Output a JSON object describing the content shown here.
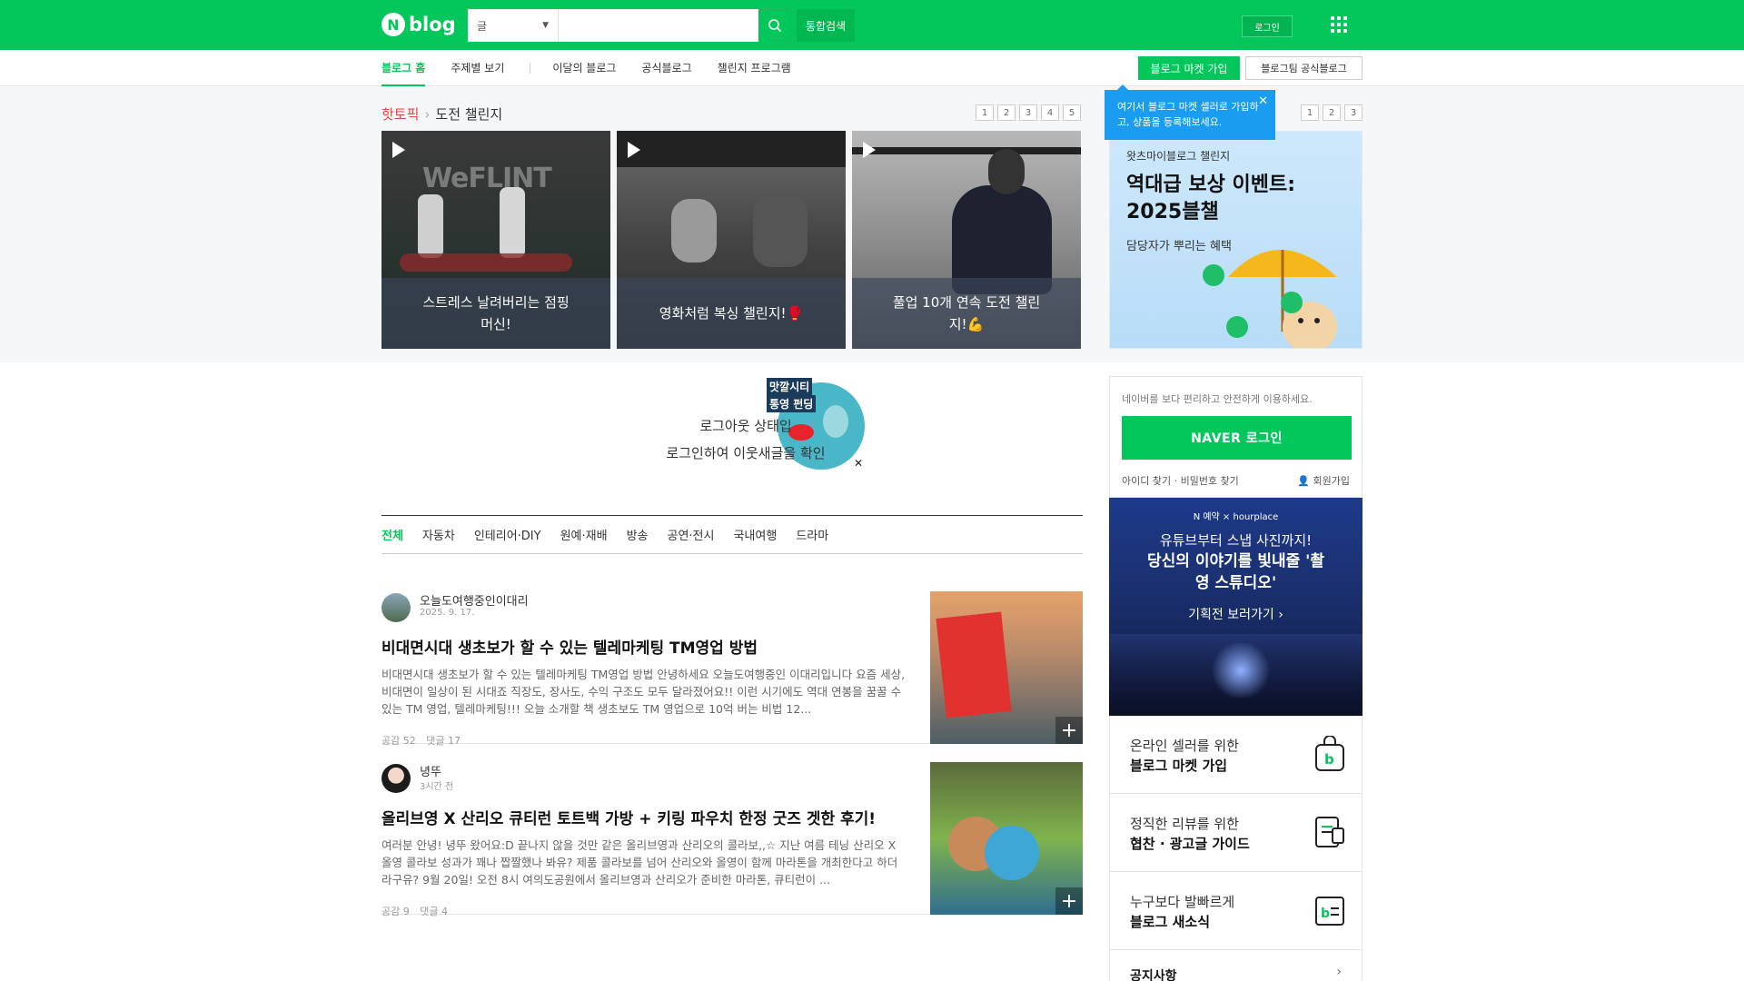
{
  "header": {
    "logo_letter": "N",
    "logo_text": "blog",
    "search_scope": "글",
    "search_value": "",
    "search_placeholder": "",
    "search_all_label": "통합검색",
    "login_label": "로그인"
  },
  "lnb": {
    "items": [
      "블로그 홈",
      "주제별 보기",
      "이달의 블로그",
      "공식블로그",
      "챌린지 프로그램"
    ],
    "market_button": "블로그 마켓 가입",
    "official_button": "블로그팀 공식블로그"
  },
  "hot_topic": {
    "label": "핫토픽",
    "subject": "도전 챌린지",
    "pages": [
      "1",
      "2",
      "3",
      "4",
      "5"
    ],
    "cards": [
      {
        "caption": "스트레스 날려버리는 점핑 머신!"
      },
      {
        "caption": "영화처럼 복싱 챌린지!🥊"
      },
      {
        "caption": "풀업 10개 연속 도전 챌린지!💪"
      }
    ]
  },
  "banner": {
    "pages": [
      "1",
      "2",
      "3"
    ],
    "kicker": "왓츠마이블로그 챌린지",
    "headline": "역대급 보상 이벤트: 2025블챌",
    "sub": "담당자가 뿌리는 혜택"
  },
  "tooltip": {
    "text": "여기서 블로그 마켓 셀러로 가입하고, 상품을 등록해보세요.",
    "close": "✕"
  },
  "feed": {
    "logout_line1": "로그아웃 상태입",
    "logout_line2": "로그인하여 이웃새글을 확인",
    "sticker_text1": "맛깔시티",
    "sticker_text2": "통영 펀딩",
    "categories": [
      "전체",
      "자동차",
      "인테리어·DIY",
      "원예·재배",
      "방송",
      "공연·전시",
      "국내여행",
      "드라마"
    ],
    "posts": [
      {
        "author": "오늘도여행중인이대리",
        "date": "2025. 9. 17.",
        "title": "비대면시대 생초보가 할 수 있는 텔레마케팅 TM영업 방법",
        "body": "비대면시대 생초보가 할 수 있는 텔레마케팅 TM영업 방법 안녕하세요 오늘도여행중인 이대리입니다 요즘 세상, 비대면이 일상이 된 시대죠 직장도, 장사도, 수익 구조도 모두 달라졌어요!! 이런 시기에도 역대 연봉을 꿈꿀 수 있는 TM 영업, 텔레마케팅!!! 오늘 소개할 책 생초보도 TM 영업으로 10억 버는 비법 12...",
        "likes": "공감 52",
        "comments": "댓글 17"
      },
      {
        "author": "녕뚜",
        "date": "3시간 전",
        "title": "올리브영 X 산리오 큐티런 토트백 가방 + 키링 파우치 한정 굿즈 겟한 후기!",
        "body": "여러분 안녕! 녕뚜 왔어요:D 끝나지 않을 것만 같은 올리브영과 산리오의 콜라보,,☆ 지난 여름 테닝 산리오 X 올영 콜라보 성과가 꽤나 짭짤했나 봐유? 제품 콜라보를 넘어 산리오와 올영이 함께 마라톤을 개최한다고 하더라구유? 9월 20일! 오전 8시 여의도공원에서 올리브영과 산리오가 준비한 마라톤, 큐티런이 ...",
        "likes": "공감 9",
        "comments": "댓글 4"
      }
    ]
  },
  "sidebar": {
    "guide": "네이버를 보다 편리하고 안전하게 이용하세요.",
    "naver_login": "NAVER 로그인",
    "find_links": "아이디 찾기 · 비밀번호 찾기",
    "join": "회원가입",
    "ad": {
      "brand": "N 예약 × hourplace",
      "line1": "유튜브부터 스냅 사진까지!",
      "line2": "당신의 이야기를 빛내줄 '촬영 스튜디오'",
      "cta": "기획전 보러가기 ›"
    },
    "promos": [
      {
        "line1": "온라인 셀러를 위한",
        "line2": "블로그 마켓 가입"
      },
      {
        "line1": "정직한 리뷰를 위한",
        "line2": "협찬 · 광고글 가이드"
      },
      {
        "line1": "누구보다 발빠르게",
        "line2": "블로그 새소식"
      }
    ],
    "notice": "공지사항"
  },
  "colors": {
    "brand": "#03c75a",
    "hot": "#e94343",
    "tooltip": "#1a9df0"
  }
}
